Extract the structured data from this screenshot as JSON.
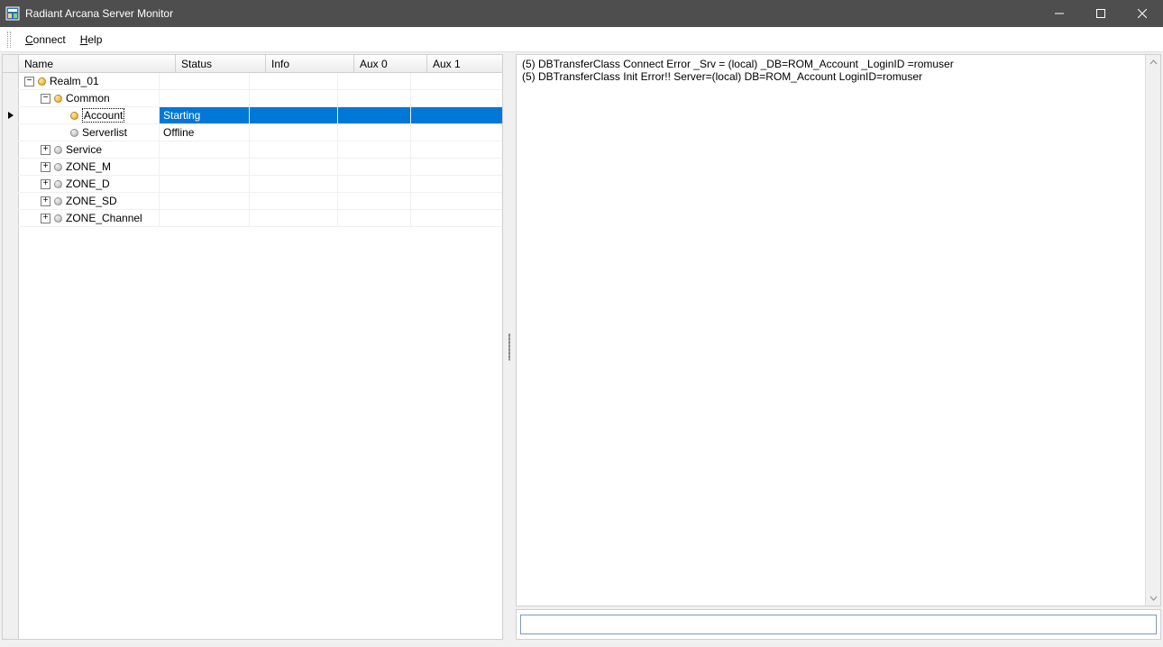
{
  "window": {
    "title": "Radiant Arcana Server Monitor"
  },
  "menu": {
    "connect": "Connect",
    "help": "Help"
  },
  "columns": {
    "name": "Name",
    "status": "Status",
    "info": "Info",
    "aux0": "Aux 0",
    "aux1": "Aux 1"
  },
  "tree": {
    "rows": [
      {
        "indent": 0,
        "expander": "-",
        "bullet": "orange",
        "label": "Realm_01",
        "status": "",
        "selected": false
      },
      {
        "indent": 1,
        "expander": "-",
        "bullet": "orange",
        "label": "Common",
        "status": "",
        "selected": false
      },
      {
        "indent": 2,
        "expander": "",
        "bullet": "orange",
        "label": "Account",
        "status": "Starting",
        "selected": true
      },
      {
        "indent": 2,
        "expander": "",
        "bullet": "grey",
        "label": "Serverlist",
        "status": "Offline",
        "selected": false
      },
      {
        "indent": 1,
        "expander": "+",
        "bullet": "grey",
        "label": "Service",
        "status": "",
        "selected": false
      },
      {
        "indent": 1,
        "expander": "+",
        "bullet": "grey",
        "label": "ZONE_M",
        "status": "",
        "selected": false
      },
      {
        "indent": 1,
        "expander": "+",
        "bullet": "grey",
        "label": "ZONE_D",
        "status": "",
        "selected": false
      },
      {
        "indent": 1,
        "expander": "+",
        "bullet": "grey",
        "label": "ZONE_SD",
        "status": "",
        "selected": false
      },
      {
        "indent": 1,
        "expander": "+",
        "bullet": "grey",
        "label": "ZONE_Channel",
        "status": "",
        "selected": false
      }
    ]
  },
  "log": {
    "lines": [
      "(5) DBTransferClass Connect Error _Srv = (local) _DB=ROM_Account _LoginID =romuser",
      "(5) DBTransferClass Init Error!! Server=(local) DB=ROM_Account LoginID=romuser"
    ]
  },
  "command": {
    "value": ""
  }
}
